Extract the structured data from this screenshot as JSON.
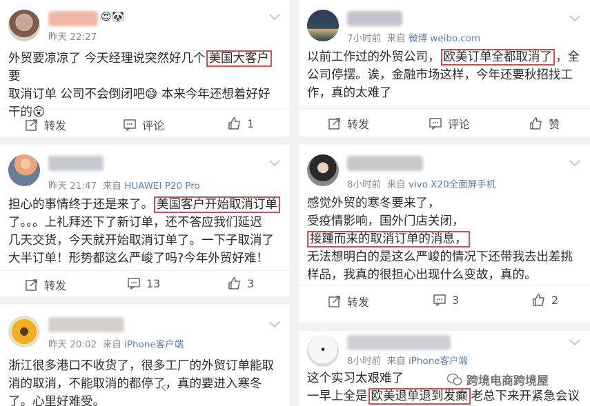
{
  "posts": [
    {
      "time": "昨天 22:27",
      "source_prefix": "",
      "source": "",
      "lines": [
        "外贸要凉凉了 今天经理说突然好几个",
        "要",
        "取消订单 公司不会倒闭吧😅 本来今年还想着好好",
        "干的😵"
      ],
      "highlight": "美国大客户",
      "actions": {
        "repost": "转发",
        "comment": "评论",
        "like": "1"
      }
    },
    {
      "time": "昨天 21:47",
      "source_prefix": "来自",
      "source": "HUAWEI P20 Pro",
      "lines": [
        "担心的事情终于还是来了。",
        "了。。。上礼拜还下了新订单，还不答应我们延迟",
        "几天交货，今天就开始取消订单了。一下子取消了",
        "大半订单！形势都这么严峻了吗?今年外贸好难！"
      ],
      "highlight": "美国客户开始取消订单",
      "actions": {
        "repost": "转发",
        "comment": "13",
        "like": "3"
      }
    },
    {
      "time": "昨天 20:02",
      "source_prefix": "来自",
      "source": "iPhone客户端",
      "lines": [
        "浙江很多港口不收货了，很多工厂的外贸订单能取",
        "消的取消，不能取消的都停了，真的要进入寒冬",
        "了。心里好难受。"
      ]
    },
    {
      "time": "7小时前",
      "source_prefix": "来自",
      "source": "微博 weibo.com",
      "lines": [
        "以前工作过的外贸公司，",
        "，全",
        "公司停摆。诶，金融市场这样，今年还要秋招找工",
        "作，真的太难了"
      ],
      "highlight": "欧美订单全都取消了",
      "actions": {
        "repost": "转发",
        "comment": "评论",
        "like": "赞"
      }
    },
    {
      "time": "8小时前",
      "source_prefix": "来自",
      "source": "vivo X20全面屏手机",
      "lines": [
        "感觉外贸的寒冬要来了，",
        "受疫情影响，国外门店关闭，",
        "",
        "无法想明白的是这么严峻的情况下还带我去出差挑",
        "样品，我真的很担心出现什么变故，真的。"
      ],
      "highlight": "接踵而来的取消订单的消息，",
      "actions": {
        "repost": "转发",
        "comment": "3",
        "like": "2"
      }
    },
    {
      "time": "8小时前",
      "source_prefix": "来自",
      "source": "iPhone客户端",
      "lines": [
        "这个实习太艰难了",
        "一早上全是",
        "老总下来开紧急会议"
      ],
      "highlight": "欧美退单退到发癫"
    }
  ],
  "watermark": "跨境电商跨境屋",
  "colors": {
    "highlight_border": "#d94a4a",
    "source_link": "#5a7fb5",
    "separator": "#f2f2f2"
  }
}
